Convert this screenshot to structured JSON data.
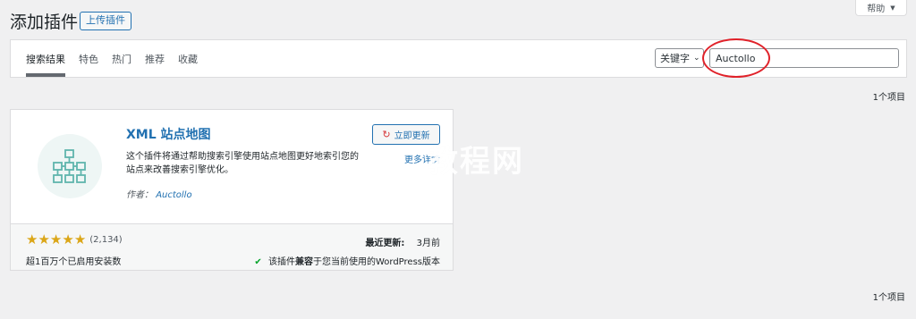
{
  "header": {
    "title": "添加插件",
    "upload_label": "上传插件",
    "help_label": "帮助"
  },
  "filter": {
    "tabs": [
      "搜索结果",
      "特色",
      "热门",
      "推荐",
      "收藏"
    ],
    "search_type": "关键字",
    "search_value": "Auctollo"
  },
  "results": {
    "count_top": "1个项目",
    "count_bottom": "1个项目"
  },
  "plugin": {
    "name": "XML 站点地图",
    "update_label": "立即更新",
    "more_details": "更多详情",
    "description": "这个插件将通过帮助搜索引擎使用站点地图更好地索引您的站点来改善搜索引擎优化。",
    "author_prefix": "作者：",
    "author": "Auctollo",
    "rating_stars": 5,
    "rating_count": "(2,134)",
    "installs": "超1百万个已启用安装数",
    "last_updated_label": "最近更新:",
    "last_updated_value": "3月前",
    "compat_prefix": "该插件",
    "compat_bold": "兼容",
    "compat_suffix": "于您当前使用的WordPress版本"
  },
  "watermark": "教程网",
  "colors": {
    "accent": "#2271b1",
    "star": "#dba617",
    "check": "#00a32a",
    "annotation": "#e0222a"
  }
}
